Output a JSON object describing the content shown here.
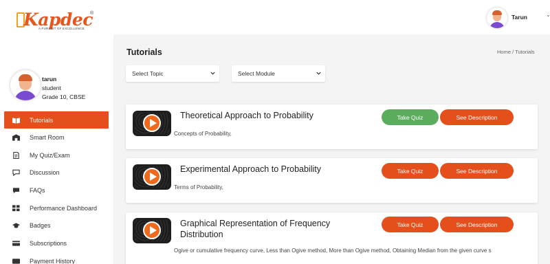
{
  "brand": {
    "name": "Kapdec",
    "tagline": "A PURSUIT OF EXCELLENCE",
    "registered": "®",
    "color": "#e8561f"
  },
  "header": {
    "user_name": "Tarun",
    "caret": "⌄"
  },
  "profile": {
    "name": "tarun",
    "role": "student",
    "grade": "Grade 10, CBSE"
  },
  "sidebar": {
    "items": [
      {
        "label": "Tutorials",
        "icon": "book-icon",
        "active": true
      },
      {
        "label": "Smart Room",
        "icon": "classroom-icon",
        "active": false
      },
      {
        "label": "My Quiz/Exam",
        "icon": "document-icon",
        "active": false
      },
      {
        "label": "Discussion",
        "icon": "chat-icon",
        "active": false
      },
      {
        "label": "FAQs",
        "icon": "faq-icon",
        "active": false
      },
      {
        "label": "Performance Dashboard",
        "icon": "dashboard-icon",
        "active": false
      },
      {
        "label": "Badges",
        "icon": "graduation-cap-icon",
        "active": false
      },
      {
        "label": "Subscriptions",
        "icon": "subscription-icon",
        "active": false
      },
      {
        "label": "Payment History",
        "icon": "payment-icon",
        "active": false
      }
    ],
    "active_color": "#e44f1c"
  },
  "main": {
    "title": "Tutorials",
    "breadcrumb": {
      "home": "Home",
      "separator": " / ",
      "current": "Tutorials"
    },
    "filters": {
      "topic": "Select Topic",
      "module": "Select Module"
    },
    "tutorials": [
      {
        "title": "Theoretical Approach to Probability",
        "description": "Concepts of Probability,",
        "quiz_label": "Take Quiz",
        "quiz_color": "#5cac5e",
        "desc_label": "See Description"
      },
      {
        "title": "Experimental Approach to Probability",
        "description": "Terms of Probability,",
        "quiz_label": "Take Quiz",
        "quiz_color": "#e44f1c",
        "desc_label": "See Description"
      },
      {
        "title": "Graphical Representation of Frequency Distribution",
        "description": "Ogive or cumulative frequency curve, Less than Ogive method, More than Ogive method, Obtaining Median from the given curve s",
        "quiz_label": "Take Quiz",
        "quiz_color": "#e44f1c",
        "desc_label": "See Description"
      }
    ]
  }
}
